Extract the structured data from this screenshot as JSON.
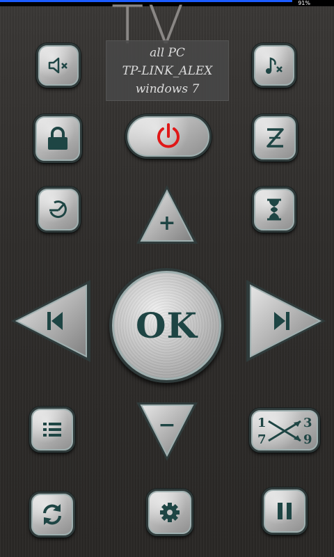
{
  "status_bar": {
    "battery": "91%"
  },
  "header": {
    "title": "TV"
  },
  "connection": {
    "line1": "all PC",
    "line2": "TP-LINK_ALEX",
    "line3": "windows 7"
  },
  "buttons": {
    "ok_label": "OK",
    "volume_up_label": "+",
    "volume_down_label": "−"
  },
  "icons": {
    "mute": "speaker-mute-icon",
    "music_mute": "music-mute-icon",
    "lock": "lock-icon",
    "power": "power-icon",
    "sleep": "sleep-z-icon",
    "timer": "timer-icon",
    "hourglass": "hourglass-icon",
    "prev": "previous-track-icon",
    "next": "next-track-icon",
    "menu": "menu-list-icon",
    "numpad": "numbers-swap-icon",
    "refresh": "refresh-icon",
    "settings": "gear-icon",
    "pause": "pause-icon"
  },
  "colors": {
    "accent": "#1e4544",
    "power_red": "#e01818",
    "statusbar_blue": "#1b5cff"
  }
}
